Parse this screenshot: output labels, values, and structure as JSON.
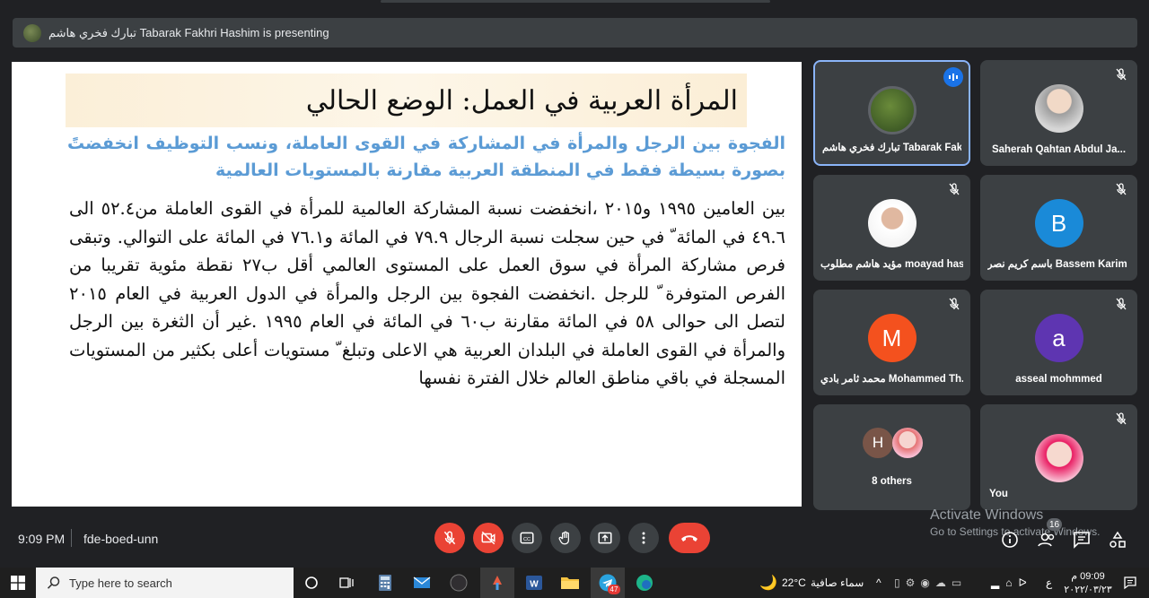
{
  "presenting_bar": {
    "text": "تبارك فخري هاشم Tabarak Fakhri Hashim is presenting"
  },
  "slide": {
    "title": "المرأة العربية في العمل: الوضع الحالي",
    "subtitle": "الفجوة بين الرجل والمرأة في المشاركة في القوى العاملة، ونسب التوظيف انخفضتً بصورة بسيطة فقط في المنطقة العربية مقارنة بالمستويات العالمية",
    "body": "بين العامين ١٩٩٥ و٢٠١٥ ،انخفضت نسبة المشاركة العالمية للمرأة في القوى العاملة من٥٢.٤ الى ٤٩.٦ في المائة ّ في حين سجلت نسبة الرجال ٧٩.٩ في المائة و٧٦.١ في المائة على التوالي. وتبقى فرص مشاركة المرأة في سوق العمل على المستوى العالمي أقل ب٢٧ نقطة مئوية تقريبا من الفرص المتوفرة ّ للرجل .انخفضت الفجوة بين الرجل والمرأة في الدول العربية في العام ٢٠١٥ لتصل الى حوالى ٥٨ في المائة مقارنة ب٦٠ في المائة في العام ١٩٩٥ .غير أن الثغرة بين الرجل والمرأة في القوى العاملة في البلدان العربية هي الاعلى وتبلغ ّ مستويات أعلى بكثير من المستويات المسجلة في باقي مناطق العالم خلال الفترة نفسها"
  },
  "participants": [
    {
      "name": "تبارك فخري هاشم Tabarak Fakh...",
      "avatar_type": "photo",
      "speaking": true
    },
    {
      "name": "Saherah Qahtan Abdul Ja...",
      "avatar_type": "photo",
      "muted": true
    },
    {
      "name": "مؤيد هاشم مطلوب moayad hash...",
      "avatar_type": "photo",
      "muted": true
    },
    {
      "name": "باسم كريم نصر Bassem Karim ...",
      "avatar_letter": "B",
      "avatar_color": "#1a8ad8",
      "muted": true
    },
    {
      "name": "محمد ثامر بادي Mohammed Th...",
      "avatar_letter": "M",
      "avatar_color": "#f4511e",
      "muted": true
    },
    {
      "name": "asseal mohmmed",
      "avatar_letter": "a",
      "avatar_color": "#5e35b1",
      "muted": true
    },
    {
      "name": "8 others",
      "avatar_letter": "H",
      "avatar_color": "#795548"
    },
    {
      "name": "You",
      "avatar_type": "photo",
      "muted": true
    }
  ],
  "meeting": {
    "time": "9:09 PM",
    "code": "fde-boed-unn",
    "people_count": "16"
  },
  "watermark": {
    "line1": "Activate Windows",
    "line2": "Go to Settings to activate Windows."
  },
  "taskbar": {
    "search_placeholder": "Type here to search",
    "weather": "22°C",
    "weather_text": "سماء صافية",
    "lang": "ع",
    "clock_time": "09:09 م",
    "clock_date": "٢٠٢٢/٠٣/٢٣",
    "telegram_badge": "47"
  },
  "colors": {
    "accent": "#1a73e8",
    "danger": "#ea4335",
    "panel": "#3c4043",
    "bg": "#202124"
  }
}
